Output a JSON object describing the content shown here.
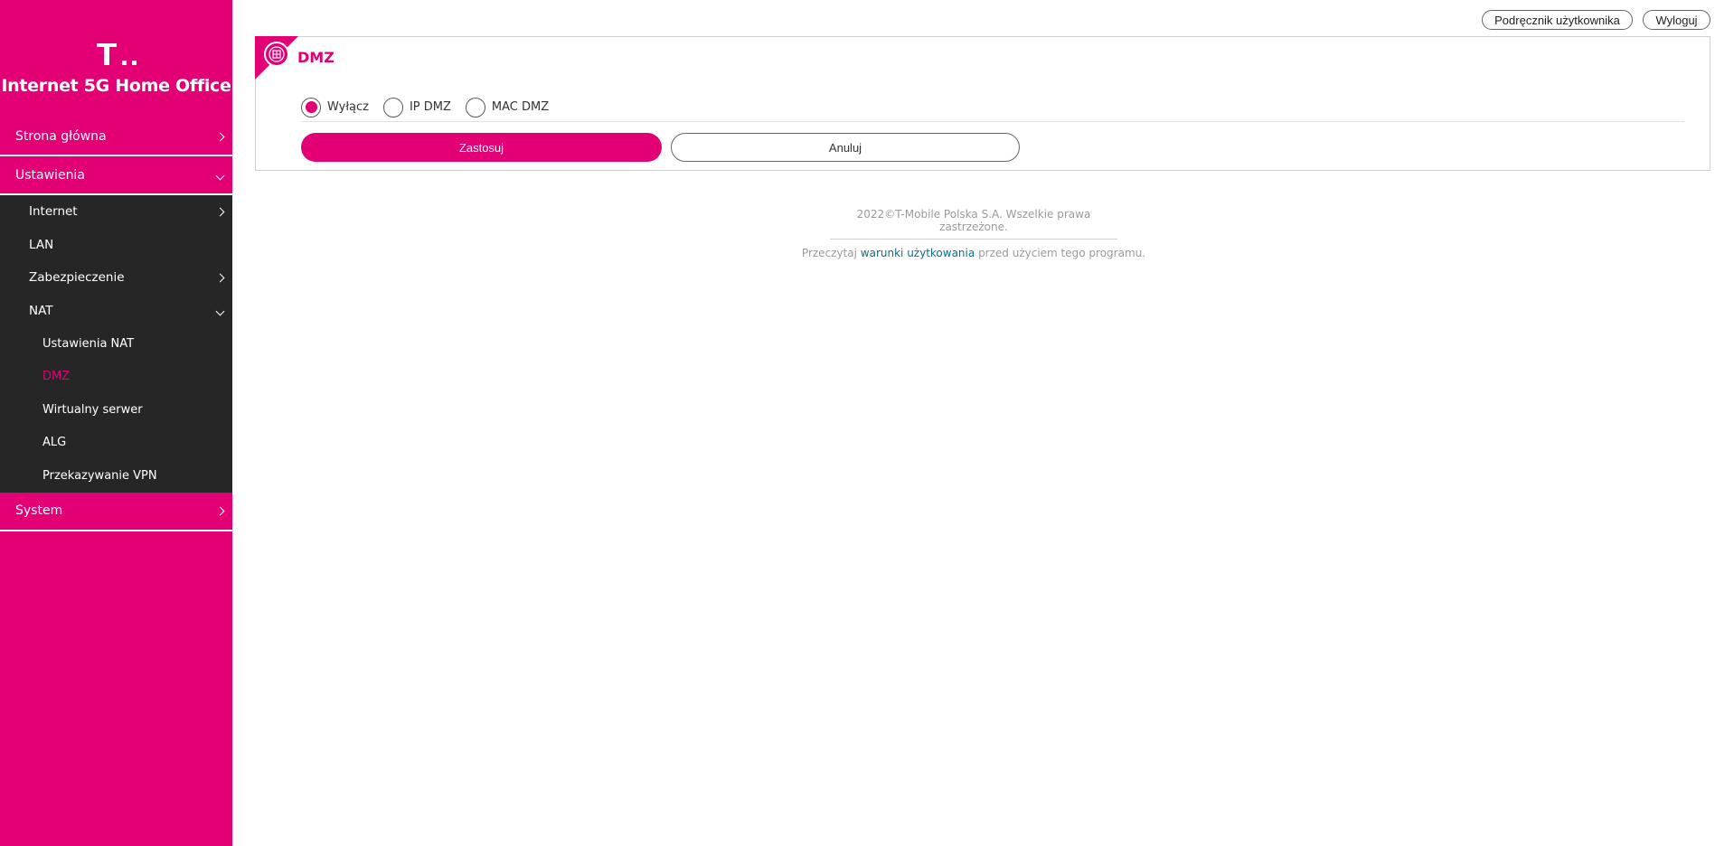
{
  "brand": {
    "title": "Internet 5G Home Office",
    "logo": "telekom-t-logo"
  },
  "header": {
    "manual_label": "Podręcznik użytkownika",
    "logout_label": "Wyloguj"
  },
  "sidebar": {
    "home": "Strona główna",
    "settings": "Ustawienia",
    "settings_sub": {
      "internet": "Internet",
      "lan": "LAN",
      "security": "Zabezpieczenie",
      "nat": "NAT",
      "nat_sub": {
        "nat_settings": "Ustawienia NAT",
        "dmz": "DMZ",
        "virtual_server": "Wirtualny serwer",
        "alg": "ALG",
        "vpn_passthrough": "Przekazywanie VPN"
      }
    },
    "system": "System",
    "active_item": "DMZ"
  },
  "panel": {
    "title": "DMZ",
    "icon": "dmz-icon",
    "options": [
      {
        "label": "Wyłącz",
        "checked": true
      },
      {
        "label": "IP DMZ",
        "checked": false
      },
      {
        "label": "MAC DMZ",
        "checked": false
      }
    ],
    "apply_label": "Zastosuj",
    "cancel_label": "Anuluj"
  },
  "footer": {
    "copyright": "2022©T-Mobile Polska S.A. Wszelkie prawa zastrzeżone.",
    "terms_prefix": "Przeczytaj",
    "terms_link": "warunki użytkowania",
    "terms_suffix": "przed użyciem tego programu."
  },
  "colors": {
    "accent": "#e20074",
    "submenu_bg": "#262626",
    "link": "#0d6e8a"
  }
}
